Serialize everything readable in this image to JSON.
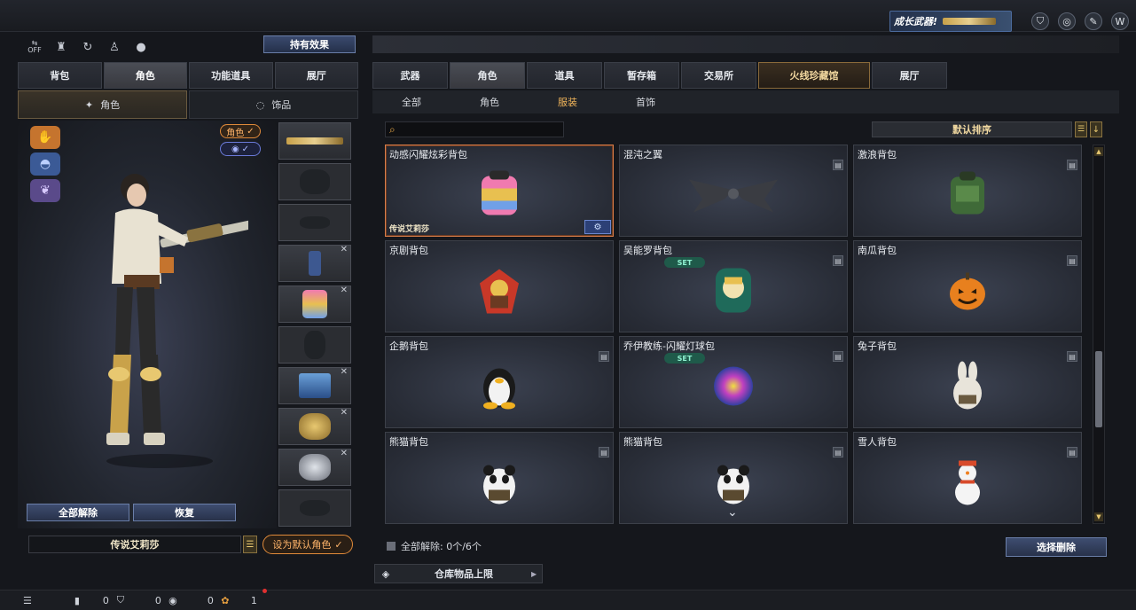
{
  "top": {
    "promo_text": "成长武器!",
    "icons": [
      "shield-badge-icon",
      "globe-icon",
      "wrench-icon",
      "brand-w-icon"
    ]
  },
  "left": {
    "util_icons": [
      "off-toggle-icon",
      "squad-icon",
      "refresh-icon",
      "walk-icon",
      "penguin-icon"
    ],
    "off_label": "OFF",
    "holding_effect": "持有效果",
    "tabs": [
      "背包",
      "角色",
      "功能道具",
      "展厅"
    ],
    "active_tab": 1,
    "subtabs": [
      {
        "label": "角色",
        "icon": "sparkle-figure-icon"
      },
      {
        "label": "饰品",
        "icon": "ring-icon"
      }
    ],
    "active_subtab": 0,
    "badge_role": "角色",
    "badge_check": "✓",
    "unequip_all": "全部解除",
    "restore": "恢复",
    "character_name": "传说艾莉莎",
    "set_default": "设为默认角色"
  },
  "right": {
    "tabs": [
      "武器",
      "角色",
      "道具",
      "暂存箱",
      "交易所",
      "火线珍藏馆",
      "展厅"
    ],
    "active_tab": 1,
    "special_tab": 5,
    "subtabs": [
      "全部",
      "角色",
      "服装",
      "首饰"
    ],
    "active_subtab": 2,
    "search_placeholder": "",
    "sort_label": "默认排序",
    "items": [
      {
        "name": "动感闪耀炫彩背包",
        "art": "rainbow-backpack",
        "selected": true,
        "owner": "传说艾莉莎",
        "trash": false,
        "set": false
      },
      {
        "name": "混沌之翼",
        "art": "wings",
        "selected": false,
        "trash": true,
        "set": false
      },
      {
        "name": "激浪背包",
        "art": "green-backpack",
        "selected": false,
        "trash": true,
        "set": false
      },
      {
        "name": "京剧背包",
        "art": "opera-backpack",
        "selected": false,
        "trash": false,
        "set": false
      },
      {
        "name": "吴能罗背包",
        "art": "doll-backpack",
        "selected": false,
        "trash": true,
        "set": true
      },
      {
        "name": "南瓜背包",
        "art": "pumpkin",
        "selected": false,
        "trash": true,
        "set": false
      },
      {
        "name": "企鹅背包",
        "art": "penguin",
        "selected": false,
        "trash": true,
        "set": false
      },
      {
        "name": "乔伊教练-闪耀灯球包",
        "art": "disco-ball",
        "selected": false,
        "trash": true,
        "set": true
      },
      {
        "name": "兔子背包",
        "art": "rabbit",
        "selected": false,
        "trash": true,
        "set": false
      },
      {
        "name": "熊猫背包",
        "art": "panda",
        "selected": false,
        "trash": true,
        "set": false
      },
      {
        "name": "熊猫背包",
        "art": "panda",
        "selected": false,
        "trash": true,
        "set": false
      },
      {
        "name": "雪人背包",
        "art": "snowman",
        "selected": false,
        "trash": true,
        "set": false
      }
    ],
    "set_label": "SET",
    "unequip_all_status": "全部解除: 0个/6个",
    "select_remove": "选择删除",
    "storage_limit": "仓库物品上限"
  },
  "bottom": {
    "counts": [
      "0",
      "0",
      "0",
      "1"
    ]
  },
  "colors": {
    "accent_orange": "#e08a3a",
    "selected_border": "#d97e4a",
    "button_blue": "#3e4d70",
    "set_badge": "#1f5a4a",
    "notification_red": "#e03030"
  }
}
